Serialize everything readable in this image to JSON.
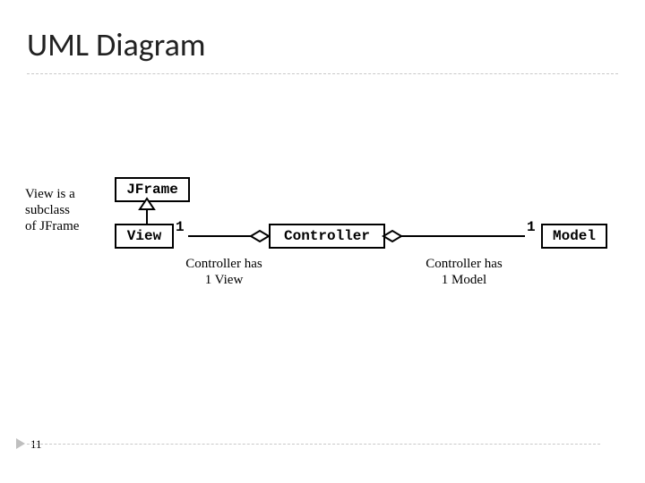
{
  "title": "UML Diagram",
  "note_left": "View is a\nsubclass\nof JFrame",
  "box_jframe": "JFrame",
  "box_view": "View",
  "box_controller": "Controller",
  "box_model": "Model",
  "mult_view": "1",
  "mult_model": "1",
  "caption_view": "Controller has\n1 View",
  "caption_model": "Controller has\n1 Model",
  "page": "11",
  "chart_data": {
    "type": "table",
    "description": "UML class diagram",
    "classes": [
      "JFrame",
      "View",
      "Controller",
      "Model"
    ],
    "relationships": [
      {
        "from": "View",
        "to": "JFrame",
        "kind": "generalization"
      },
      {
        "from": "Controller",
        "to": "View",
        "kind": "aggregation",
        "multiplicity": "1"
      },
      {
        "from": "Controller",
        "to": "Model",
        "kind": "aggregation",
        "multiplicity": "1"
      }
    ]
  }
}
